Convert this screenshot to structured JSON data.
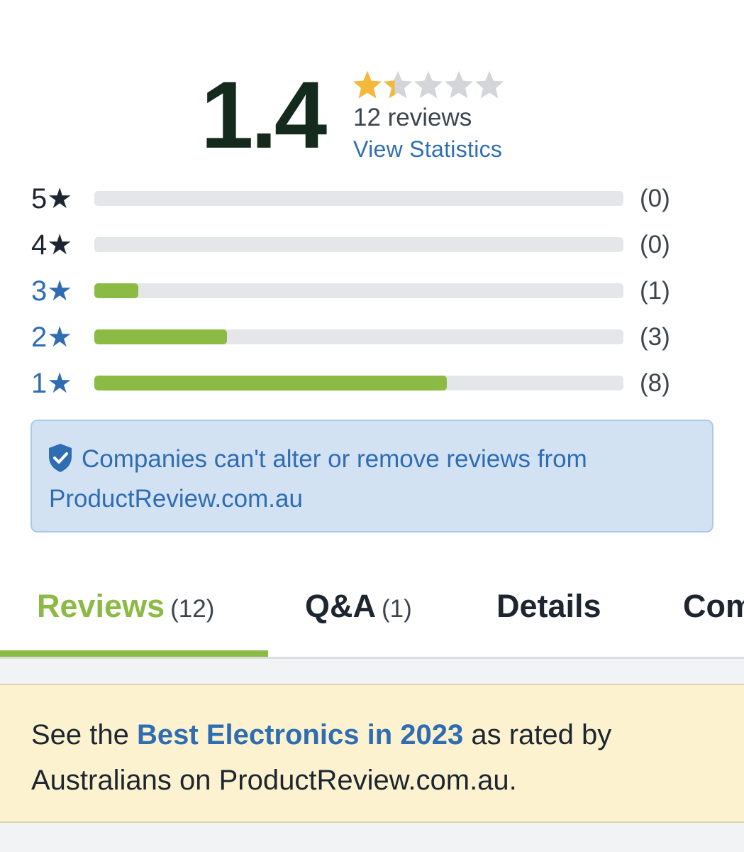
{
  "summary": {
    "score": "1.4",
    "rating_value": 1.4,
    "rating_max": 5,
    "review_count": "12 reviews",
    "view_stats": "View Statistics",
    "star_color_filled": "#f4b93a",
    "star_color_empty": "#d4d5d9"
  },
  "histogram": [
    {
      "label": "5★",
      "stars": 5,
      "count_text": "(0)",
      "count": 0,
      "style": "dark"
    },
    {
      "label": "4★",
      "stars": 4,
      "count_text": "(0)",
      "count": 0,
      "style": "dark"
    },
    {
      "label": "3★",
      "stars": 3,
      "count_text": "(1)",
      "count": 1,
      "style": "blue"
    },
    {
      "label": "2★",
      "stars": 2,
      "count_text": "(3)",
      "count": 3,
      "style": "blue"
    },
    {
      "label": "1★",
      "stars": 1,
      "count_text": "(8)",
      "count": 8,
      "style": "blue"
    }
  ],
  "histogram_max": 12,
  "notice": {
    "text": "Companies can't alter or remove reviews from ProductReview.com.au",
    "icon": "shield-check-icon"
  },
  "tabs": [
    {
      "label": "Reviews",
      "count": "(12)",
      "active": true
    },
    {
      "label": "Q&A",
      "count": "(1)",
      "active": false
    },
    {
      "label": "Details",
      "count": "",
      "active": false
    },
    {
      "label": "Com",
      "count": "",
      "active": false
    }
  ],
  "banner": {
    "prefix": "See the ",
    "link": "Best Electronics in 2023",
    "suffix": " as rated by Australians on ProductReview.com.au."
  },
  "colors": {
    "accent_green": "#8cbb45",
    "link_blue": "#2f6db3",
    "score_dark": "#132a1c",
    "notice_bg": "#d3e2f3",
    "banner_bg": "#fcf2cf"
  }
}
